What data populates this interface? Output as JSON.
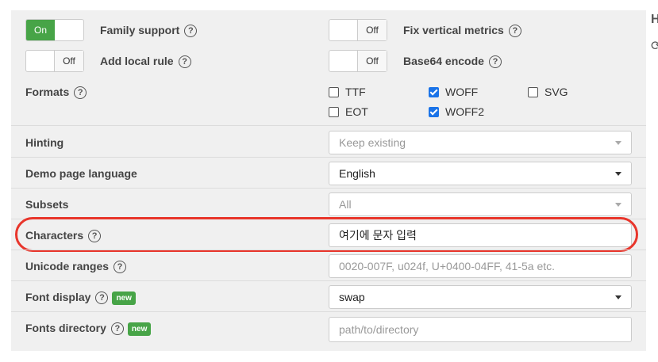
{
  "toggles": {
    "family_support": {
      "label": "Family support",
      "on_label": "On",
      "state": "on"
    },
    "add_local_rule": {
      "label": "Add local rule",
      "off_label": "Off",
      "state": "off"
    },
    "fix_vertical_metrics": {
      "label": "Fix vertical metrics",
      "off_label": "Off",
      "state": "off"
    },
    "base64_encode": {
      "label": "Base64 encode",
      "off_label": "Off",
      "state": "off"
    }
  },
  "formats": {
    "label": "Formats",
    "options": [
      {
        "label": "TTF",
        "checked": false
      },
      {
        "label": "EOT",
        "checked": false
      },
      {
        "label": "WOFF",
        "checked": true
      },
      {
        "label": "WOFF2",
        "checked": true
      },
      {
        "label": "SVG",
        "checked": false
      }
    ]
  },
  "hinting": {
    "label": "Hinting",
    "value": "Keep existing"
  },
  "demo_language": {
    "label": "Demo page language",
    "value": "English"
  },
  "subsets": {
    "label": "Subsets",
    "value": "All"
  },
  "characters": {
    "label": "Characters",
    "value": "여기에 문자 입력"
  },
  "unicode_ranges": {
    "label": "Unicode ranges",
    "placeholder": "0020-007F, u024f, U+0400-04FF, 41-5a etc."
  },
  "font_display": {
    "label": "Font display",
    "badge": "new",
    "value": "swap"
  },
  "fonts_directory": {
    "label": "Fonts directory",
    "badge": "new",
    "placeholder": "path/to/directory"
  },
  "help_glyph": "?",
  "edge_glyphs": {
    "top": "H",
    "bottom": "⟳"
  }
}
